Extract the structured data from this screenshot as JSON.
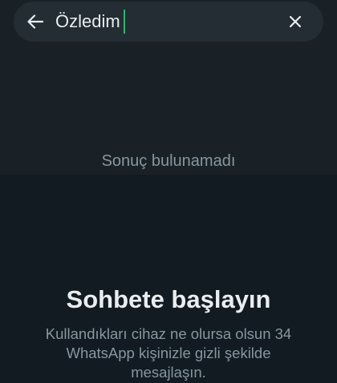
{
  "search": {
    "value": "Özledim",
    "back_icon": "arrow-left-icon",
    "clear_icon": "close-icon"
  },
  "results": {
    "empty_text": "Sonuç bulunamadı"
  },
  "start_chat": {
    "title": "Sohbete başlayın",
    "description": "Kullandıkları cihaz ne olursa olsun 34 WhatsApp kişinizle gizli şekilde mesajlaşın."
  },
  "colors": {
    "background": "#111b21",
    "search_bar": "#232d33",
    "caret": "#21c063",
    "primary_text": "#e9edef",
    "secondary_text": "#8696a0"
  }
}
